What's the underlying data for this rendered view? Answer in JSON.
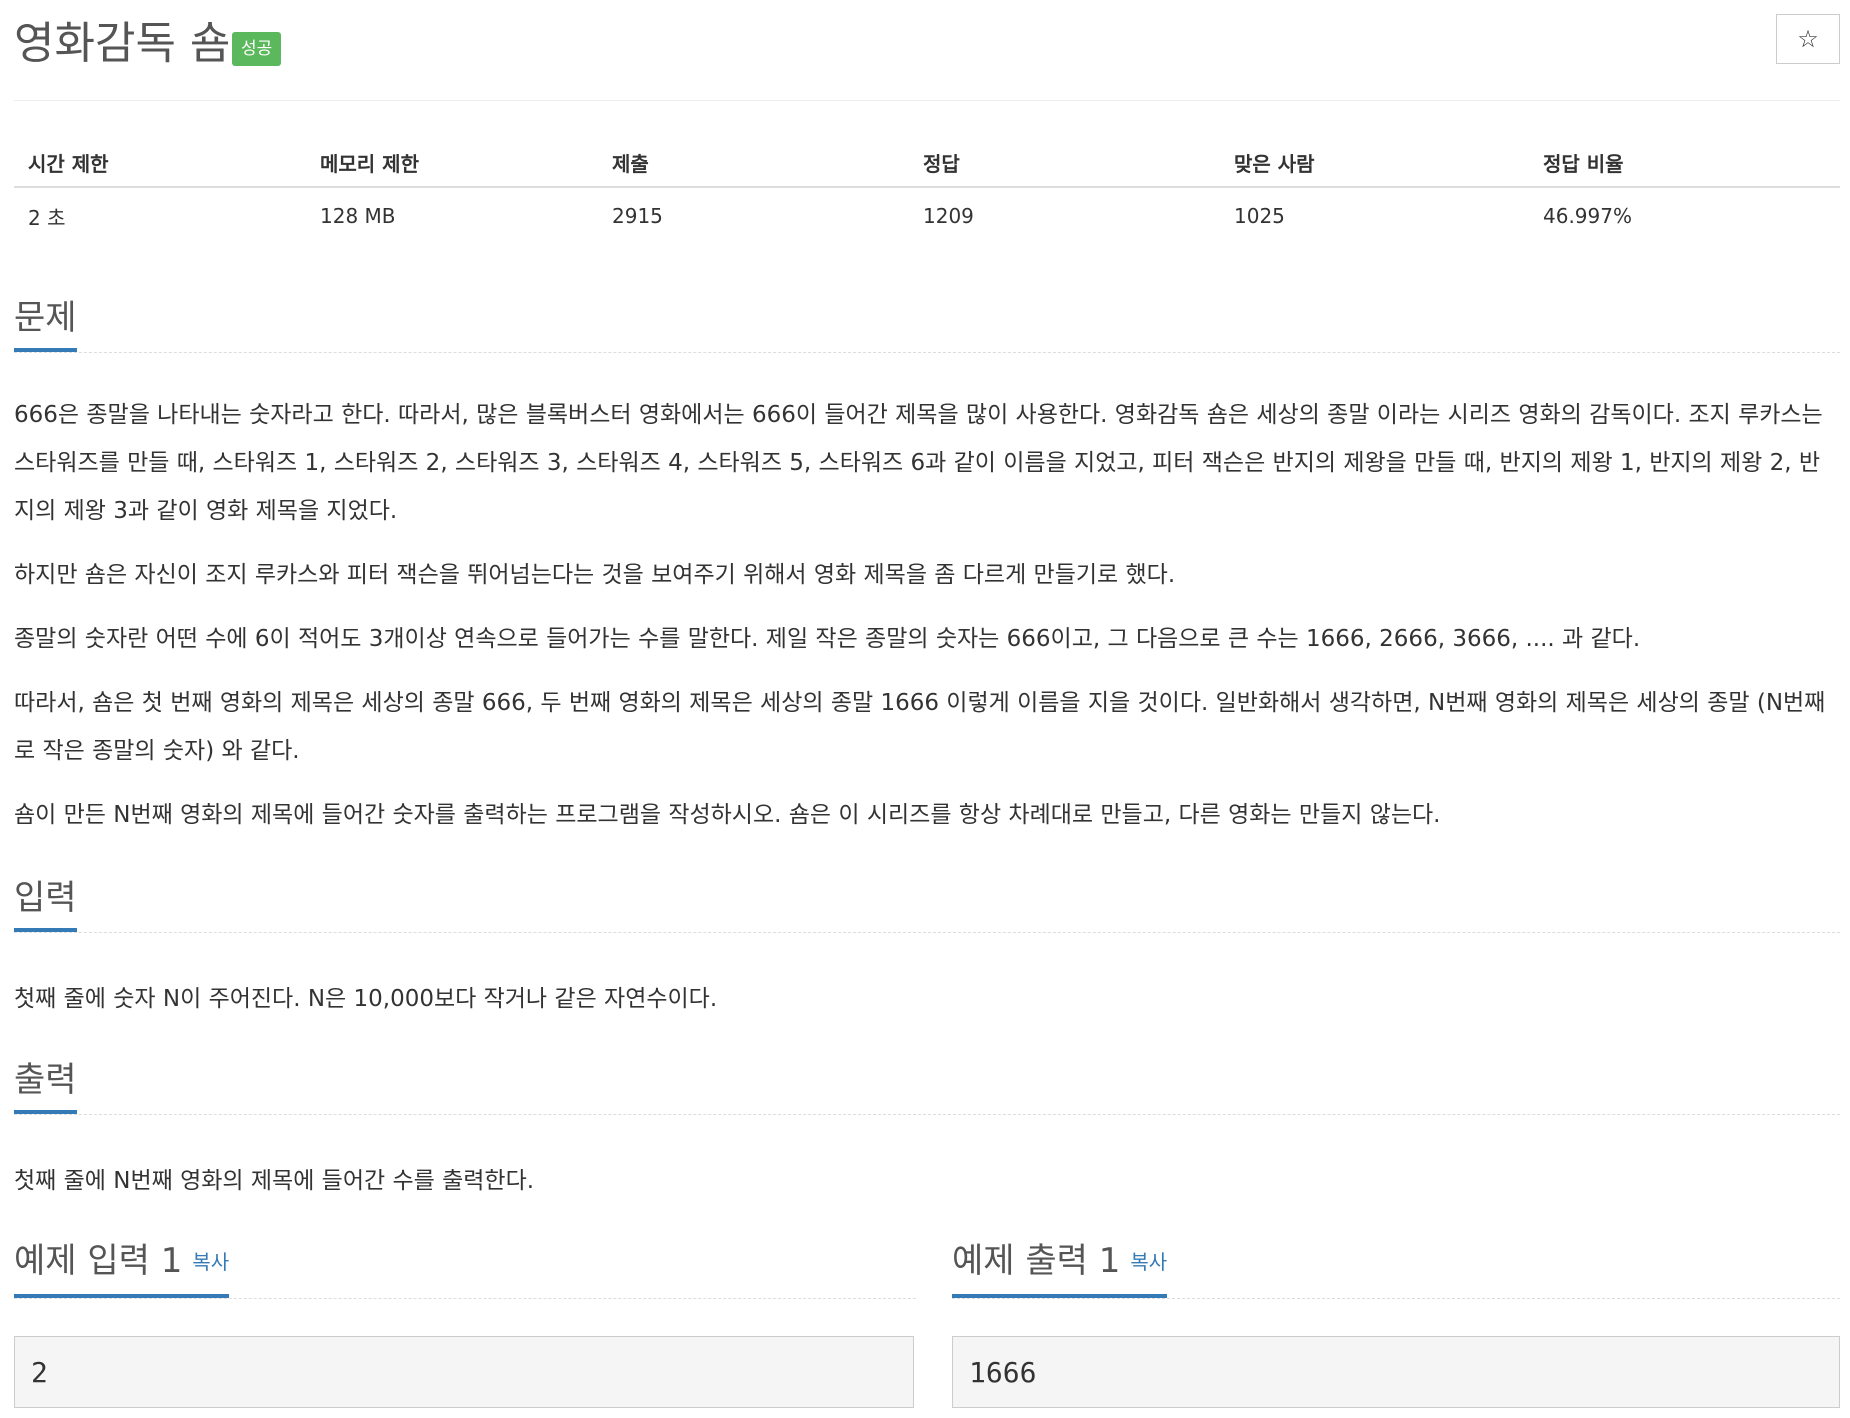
{
  "header": {
    "title": "영화감독 숌",
    "badge": "성공",
    "star_icon": "☆"
  },
  "info": {
    "columns": [
      "시간 제한",
      "메모리 제한",
      "제출",
      "정답",
      "맞은 사람",
      "정답 비율"
    ],
    "values": [
      "2 초",
      "128 MB",
      "2915",
      "1209",
      "1025",
      "46.997%"
    ]
  },
  "sections": {
    "problem": {
      "heading": "문제",
      "paragraphs": [
        "666은 종말을 나타내는 숫자라고 한다. 따라서, 많은 블록버스터 영화에서는 666이 들어간 제목을 많이 사용한다. 영화감독 숌은 세상의 종말 이라는 시리즈 영화의 감독이다. 조지 루카스는 스타워즈를 만들 때, 스타워즈 1, 스타워즈 2, 스타워즈 3, 스타워즈 4, 스타워즈 5, 스타워즈 6과 같이 이름을 지었고, 피터 잭슨은 반지의 제왕을 만들 때, 반지의 제왕 1, 반지의 제왕 2, 반지의 제왕 3과 같이 영화 제목을 지었다.",
        "하지만 숌은 자신이 조지 루카스와 피터 잭슨을 뛰어넘는다는 것을 보여주기 위해서 영화 제목을 좀 다르게 만들기로 했다.",
        "종말의 숫자란 어떤 수에 6이 적어도 3개이상 연속으로 들어가는 수를 말한다. 제일 작은 종말의 숫자는 666이고, 그 다음으로 큰 수는 1666, 2666, 3666, .... 과 같다.",
        "따라서, 숌은 첫 번째 영화의 제목은 세상의 종말 666, 두 번째 영화의 제목은 세상의 종말 1666 이렇게 이름을 지을 것이다. 일반화해서 생각하면, N번째 영화의 제목은 세상의 종말 (N번째로 작은 종말의 숫자) 와 같다.",
        "숌이 만든 N번째 영화의 제목에 들어간 숫자를 출력하는 프로그램을 작성하시오. 숌은 이 시리즈를 항상 차례대로 만들고, 다른 영화는 만들지 않는다."
      ]
    },
    "input": {
      "heading": "입력",
      "text": "첫째 줄에 숫자 N이 주어진다. N은 10,000보다 작거나 같은 자연수이다."
    },
    "output": {
      "heading": "출력",
      "text": "첫째 줄에 N번째 영화의 제목에 들어간 수를 출력한다."
    }
  },
  "samples": {
    "input": {
      "heading": "예제 입력 1",
      "copy_label": "복사",
      "value": "2"
    },
    "output": {
      "heading": "예제 출력 1",
      "copy_label": "복사",
      "value": "1666"
    }
  },
  "colors": {
    "accent": "#337ab7",
    "badge": "#5cb85c"
  }
}
